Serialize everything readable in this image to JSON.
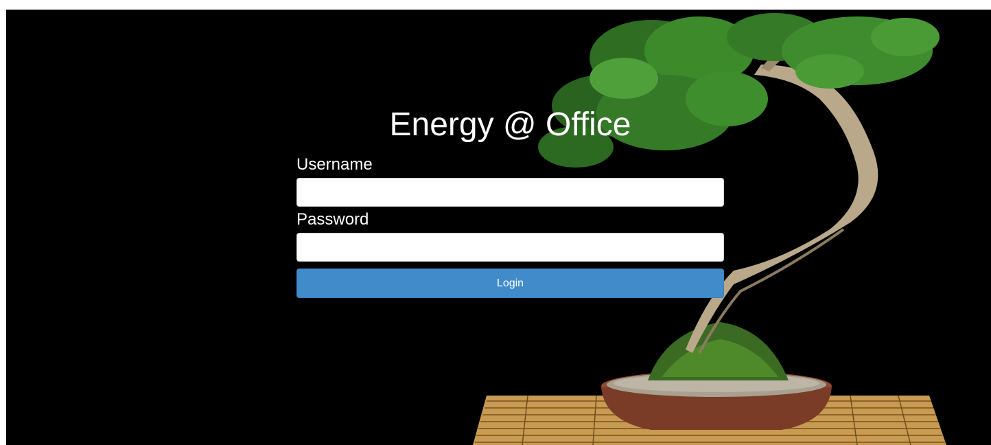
{
  "app": {
    "title": "Energy @ Office"
  },
  "form": {
    "username_label": "Username",
    "username_value": "",
    "password_label": "Password",
    "password_value": "",
    "login_label": "Login"
  },
  "colors": {
    "background": "#000000",
    "button": "#428bca",
    "text": "#ffffff"
  },
  "decor": {
    "background_image": "bonsai-tree-on-bamboo-mat"
  }
}
